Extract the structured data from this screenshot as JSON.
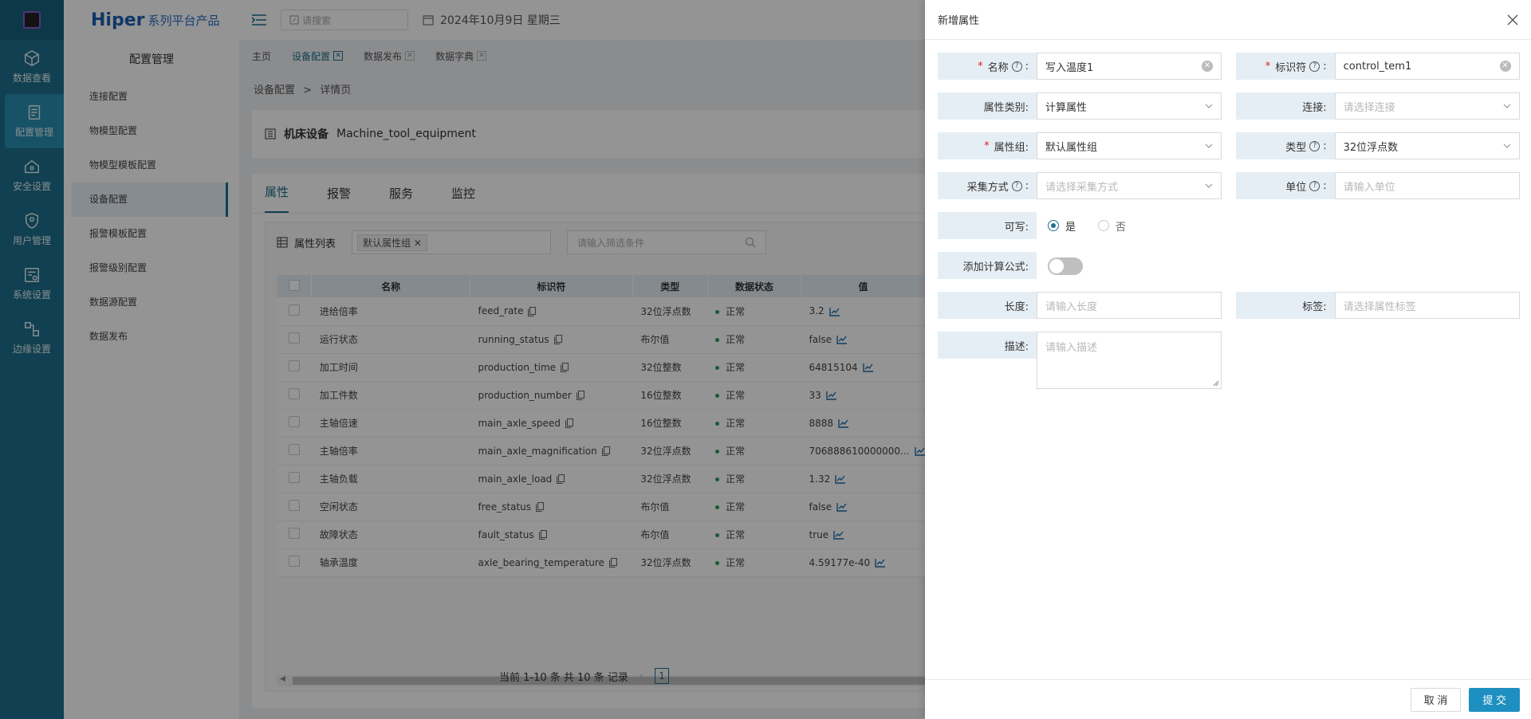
{
  "rail": {
    "items": [
      {
        "label": "数据查看",
        "icon": "cube-icon"
      },
      {
        "label": "配置管理",
        "icon": "config-icon"
      },
      {
        "label": "安全设置",
        "icon": "security-home-icon"
      },
      {
        "label": "用户管理",
        "icon": "user-shield-icon"
      },
      {
        "label": "系统设置",
        "icon": "system-settings-icon"
      },
      {
        "label": "边缘设置",
        "icon": "edge-icon"
      }
    ]
  },
  "brand": {
    "name": "Hiper",
    "suffix": "系列平台产品"
  },
  "submenu": {
    "title": "配置管理",
    "items": [
      "连接配置",
      "物模型配置",
      "物模型模板配置",
      "设备配置",
      "报警模板配置",
      "报警级别配置",
      "数据源配置",
      "数据发布"
    ]
  },
  "topbar": {
    "search_placeholder": "请搜索",
    "date": "2024年10月9日 星期三"
  },
  "tabs": [
    "主页",
    "设备配置",
    "数据发布",
    "数据字典"
  ],
  "breadcrumb": {
    "parent": "设备配置",
    "sep": ">",
    "current": "详情页"
  },
  "device": {
    "name": "机床设备",
    "code": "Machine_tool_equipment"
  },
  "attr_tabs": [
    "属性",
    "报警",
    "服务",
    "监控"
  ],
  "list": {
    "title": "属性列表",
    "chip": "默认属性组",
    "filter_placeholder": "请输入筛选条件",
    "columns": [
      "名称",
      "标识符",
      "类型",
      "数据状态",
      "值"
    ],
    "rows": [
      {
        "name": "进给倍率",
        "id": "feed_rate",
        "type": "32位浮点数",
        "status": "正常",
        "value": "3.2"
      },
      {
        "name": "运行状态",
        "id": "running_status",
        "type": "布尔值",
        "status": "正常",
        "value": "false"
      },
      {
        "name": "加工时间",
        "id": "production_time",
        "type": "32位整数",
        "status": "正常",
        "value": "64815104"
      },
      {
        "name": "加工件数",
        "id": "production_number",
        "type": "16位整数",
        "status": "正常",
        "value": "33"
      },
      {
        "name": "主轴倍速",
        "id": "main_axle_speed",
        "type": "16位整数",
        "status": "正常",
        "value": "8888"
      },
      {
        "name": "主轴倍率",
        "id": "main_axle_magnification",
        "type": "32位浮点数",
        "status": "正常",
        "value": "706888610000000..."
      },
      {
        "name": "主轴负载",
        "id": "main_axle_load",
        "type": "32位浮点数",
        "status": "正常",
        "value": "1.32"
      },
      {
        "name": "空闲状态",
        "id": "free_status",
        "type": "布尔值",
        "status": "正常",
        "value": "false"
      },
      {
        "name": "故障状态",
        "id": "fault_status",
        "type": "布尔值",
        "status": "正常",
        "value": "true"
      },
      {
        "name": "轴承温度",
        "id": "axle_bearing_temperature",
        "type": "32位浮点数",
        "status": "正常",
        "value": "4.59177e-40"
      }
    ],
    "pager_text": "当前 1-10 条 共 10 条 记录",
    "page": "1"
  },
  "drawer": {
    "title": "新增属性",
    "fields": {
      "name_label": "名称",
      "name_value": "写入温度1",
      "ident_label": "标识符",
      "ident_value": "control_tem1",
      "category_label": "属性类别:",
      "category_value": "计算属性",
      "connection_label": "连接:",
      "connection_placeholder": "请选择连接",
      "group_label": "属性组:",
      "group_value": "默认属性组",
      "type_label": "类型",
      "type_value": "32位浮点数",
      "collect_label": "采集方式",
      "collect_placeholder": "请选择采集方式",
      "unit_label": "单位",
      "unit_placeholder": "请输入单位",
      "writable_label": "可写:",
      "writable_yes": "是",
      "writable_no": "否",
      "formula_label": "添加计算公式:",
      "length_label": "长度:",
      "length_placeholder": "请输入长度",
      "tag_label": "标签:",
      "tag_placeholder": "请选择属性标签",
      "desc_label": "描述:",
      "desc_placeholder": "请输入描述"
    },
    "cancel_label": "取 消",
    "submit_label": "提 交"
  },
  "colors": {
    "accent": "#1d6f8c",
    "submit": "#1d8fc0",
    "status_ok": "#2e9b5a"
  }
}
